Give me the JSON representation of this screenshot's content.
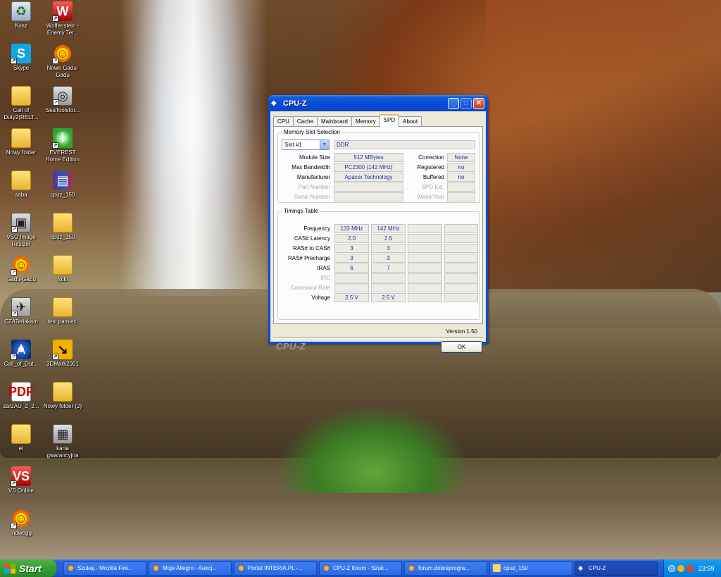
{
  "desktop": {
    "icons": [
      {
        "label": "Kosz",
        "icon": "recycle-bin-icon"
      },
      {
        "label": "Wolfenstein - Enemy Ter...",
        "icon": "wolfenstein-icon"
      },
      {
        "label": "Skype",
        "icon": "skype-icon"
      },
      {
        "label": "Nowe Gadu-Gadu",
        "icon": "gadu-gadu-icon"
      },
      {
        "label": "Call of Duty2(RELT...",
        "icon": "folder-icon"
      },
      {
        "label": "SeaToolsfor...",
        "icon": "seatools-icon"
      },
      {
        "label": "Nowy folder",
        "icon": "folder-icon"
      },
      {
        "label": "EVEREST Home Edition",
        "icon": "everest-icon"
      },
      {
        "label": "saba",
        "icon": "folder-icon"
      },
      {
        "label": "cpuz_150",
        "icon": "winrar-icon"
      },
      {
        "label": "VSO Image Resizer",
        "icon": "vso-icon"
      },
      {
        "label": "cpuz_150",
        "icon": "folder-icon"
      },
      {
        "label": "Gadu-Gadu",
        "icon": "gadu-gadu-icon"
      },
      {
        "label": "fotki",
        "icon": "folder-icon"
      },
      {
        "label": "CZATeriakam",
        "icon": "czat-icon"
      },
      {
        "label": "test pamięci",
        "icon": "folder-icon"
      },
      {
        "label": "Call_of_Dut...",
        "icon": "call-of-duty-icon"
      },
      {
        "label": "3DMark2001",
        "icon": "3dmark-icon"
      },
      {
        "label": "zarzAU_2_2...",
        "icon": "pdf-icon"
      },
      {
        "label": "Nowy folder (2)",
        "icon": "folder-icon"
      },
      {
        "label": "et",
        "icon": "folder-icon"
      },
      {
        "label": "karta gwarancyjna",
        "icon": "document-icon"
      },
      {
        "label": "VS Online",
        "icon": "vs-online-icon"
      },
      {
        "label": "indwegg",
        "icon": "gadu-gadu-icon"
      }
    ]
  },
  "window": {
    "title": "CPU-Z",
    "tabs": [
      "CPU",
      "Cache",
      "Mainboard",
      "Memory",
      "SPD",
      "About"
    ],
    "active_tab": "SPD",
    "slot_group": {
      "title": "Memory Slot Selection",
      "slot_select": "Slot #1",
      "type": "DDR",
      "rows": [
        {
          "label": "Module Size",
          "value": "512 MBytes",
          "rlabel": "Correction",
          "rvalue": "None"
        },
        {
          "label": "Max Bandwidth",
          "value": "PC2300 (142 MHz)",
          "rlabel": "Registered",
          "rvalue": "no"
        },
        {
          "label": "Manufacturer",
          "value": "Apacer Technology",
          "rlabel": "Buffered",
          "rvalue": "no"
        },
        {
          "label": "Part Number",
          "value": "",
          "rlabel": "SPD Ext.",
          "rvalue": ""
        },
        {
          "label": "Serial Number",
          "value": "",
          "rlabel": "Week/Year",
          "rvalue": ""
        }
      ]
    },
    "timings": {
      "title": "Timings Table",
      "rows": [
        {
          "label": "Frequency",
          "c1": "133 MHz",
          "c2": "142 MHz"
        },
        {
          "label": "CAS# Latency",
          "c1": "2.0",
          "c2": "2.5"
        },
        {
          "label": "RAS# to CAS#",
          "c1": "3",
          "c2": "3"
        },
        {
          "label": "RAS# Precharge",
          "c1": "3",
          "c2": "3"
        },
        {
          "label": "tRAS",
          "c1": "6",
          "c2": "7"
        },
        {
          "label": "tRC",
          "c1": "",
          "c2": ""
        },
        {
          "label": "Command Rate",
          "c1": "",
          "c2": ""
        },
        {
          "label": "Voltage",
          "c1": "2.5 V",
          "c2": "2.5 V"
        }
      ]
    },
    "version": "Version 1.50",
    "brand": "CPU-Z",
    "ok_label": "OK"
  },
  "taskbar": {
    "start_label": "Start",
    "tasks": [
      {
        "label": "Szukaj - Mozilla Fire...",
        "icon": "firefox-icon"
      },
      {
        "label": "Moje Allegro - Aukcj...",
        "icon": "firefox-icon"
      },
      {
        "label": "Portal INTERIA.PL -...",
        "icon": "firefox-icon"
      },
      {
        "label": "CPU-Z forum - Szuk...",
        "icon": "firefox-icon"
      },
      {
        "label": "forum.dobreprogra...",
        "icon": "firefox-icon"
      },
      {
        "label": "cpuz_150",
        "icon": "folder-icon"
      },
      {
        "label": "CPU-Z",
        "icon": "cpuz-icon"
      }
    ],
    "clock": "23:59"
  }
}
